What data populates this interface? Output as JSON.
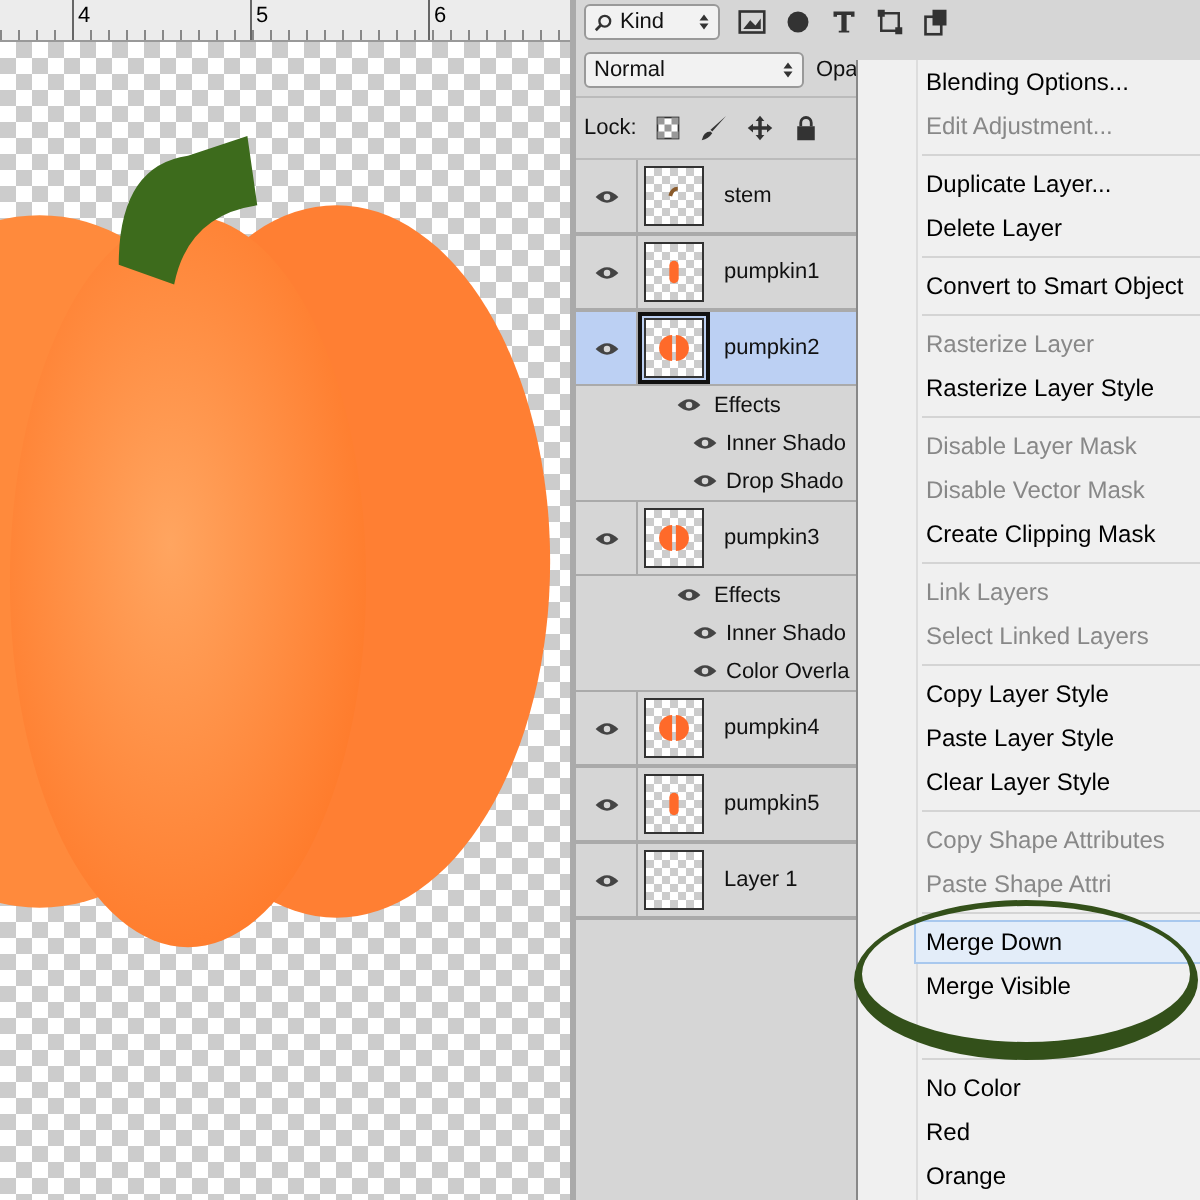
{
  "ruler": {
    "labels": [
      "4",
      "5",
      "6"
    ]
  },
  "layers_panel": {
    "filter": {
      "label": "Kind"
    },
    "blend_mode": {
      "value": "Normal"
    },
    "opacity_label": "Opa",
    "lock_label": "Lock:",
    "layers": [
      {
        "name": "stem",
        "kind": "stem",
        "visible": true,
        "selected": false
      },
      {
        "name": "pumpkin1",
        "kind": "single",
        "visible": true,
        "selected": false
      },
      {
        "name": "pumpkin2",
        "kind": "split",
        "visible": true,
        "selected": true,
        "effects": {
          "label": "Effects",
          "children": [
            {
              "name": "Inner Shado"
            },
            {
              "name": "Drop Shado"
            }
          ]
        }
      },
      {
        "name": "pumpkin3",
        "kind": "split",
        "visible": true,
        "selected": false,
        "effects": {
          "label": "Effects",
          "children": [
            {
              "name": "Inner Shado"
            },
            {
              "name": "Color Overla"
            }
          ]
        }
      },
      {
        "name": "pumpkin4",
        "kind": "split",
        "visible": true,
        "selected": false
      },
      {
        "name": "pumpkin5",
        "kind": "single",
        "visible": true,
        "selected": false
      },
      {
        "name": "Layer 1",
        "kind": "empty",
        "visible": true,
        "selected": false
      }
    ]
  },
  "context_menu": {
    "items": [
      {
        "kind": "item",
        "label": "Blending Options...",
        "disabled": false,
        "selected": false
      },
      {
        "kind": "item",
        "label": "Edit Adjustment...",
        "disabled": true,
        "selected": false
      },
      {
        "kind": "separator"
      },
      {
        "kind": "item",
        "label": "Duplicate Layer...",
        "disabled": false,
        "selected": false
      },
      {
        "kind": "item",
        "label": "Delete Layer",
        "disabled": false,
        "selected": false
      },
      {
        "kind": "separator"
      },
      {
        "kind": "item",
        "label": "Convert to Smart Object",
        "disabled": false,
        "selected": false
      },
      {
        "kind": "separator"
      },
      {
        "kind": "item",
        "label": "Rasterize Layer",
        "disabled": true,
        "selected": false
      },
      {
        "kind": "item",
        "label": "Rasterize Layer Style",
        "disabled": false,
        "selected": false
      },
      {
        "kind": "separator"
      },
      {
        "kind": "item",
        "label": "Disable Layer Mask",
        "disabled": true,
        "selected": false
      },
      {
        "kind": "item",
        "label": "Disable Vector Mask",
        "disabled": true,
        "selected": false
      },
      {
        "kind": "item",
        "label": "Create Clipping Mask",
        "disabled": false,
        "selected": false
      },
      {
        "kind": "separator"
      },
      {
        "kind": "item",
        "label": "Link Layers",
        "disabled": true,
        "selected": false
      },
      {
        "kind": "item",
        "label": "Select Linked Layers",
        "disabled": true,
        "selected": false
      },
      {
        "kind": "separator"
      },
      {
        "kind": "item",
        "label": "Copy Layer Style",
        "disabled": false,
        "selected": false
      },
      {
        "kind": "item",
        "label": "Paste Layer Style",
        "disabled": false,
        "selected": false
      },
      {
        "kind": "item",
        "label": "Clear Layer Style",
        "disabled": false,
        "selected": false
      },
      {
        "kind": "separator"
      },
      {
        "kind": "item",
        "label": "Copy Shape Attributes",
        "disabled": true,
        "selected": false
      },
      {
        "kind": "item",
        "label": "Paste Shape Attri",
        "disabled": true,
        "selected": false
      },
      {
        "kind": "separator"
      },
      {
        "kind": "item",
        "label": "Merge Down",
        "disabled": false,
        "selected": true
      },
      {
        "kind": "item",
        "label": "Merge Visible",
        "disabled": false,
        "selected": false
      },
      {
        "kind": "hidden"
      },
      {
        "kind": "separator"
      },
      {
        "kind": "item",
        "label": "No Color",
        "disabled": false,
        "selected": false
      },
      {
        "kind": "item",
        "label": "Red",
        "disabled": false,
        "selected": false
      },
      {
        "kind": "item",
        "label": "Orange",
        "disabled": false,
        "selected": false
      }
    ]
  }
}
